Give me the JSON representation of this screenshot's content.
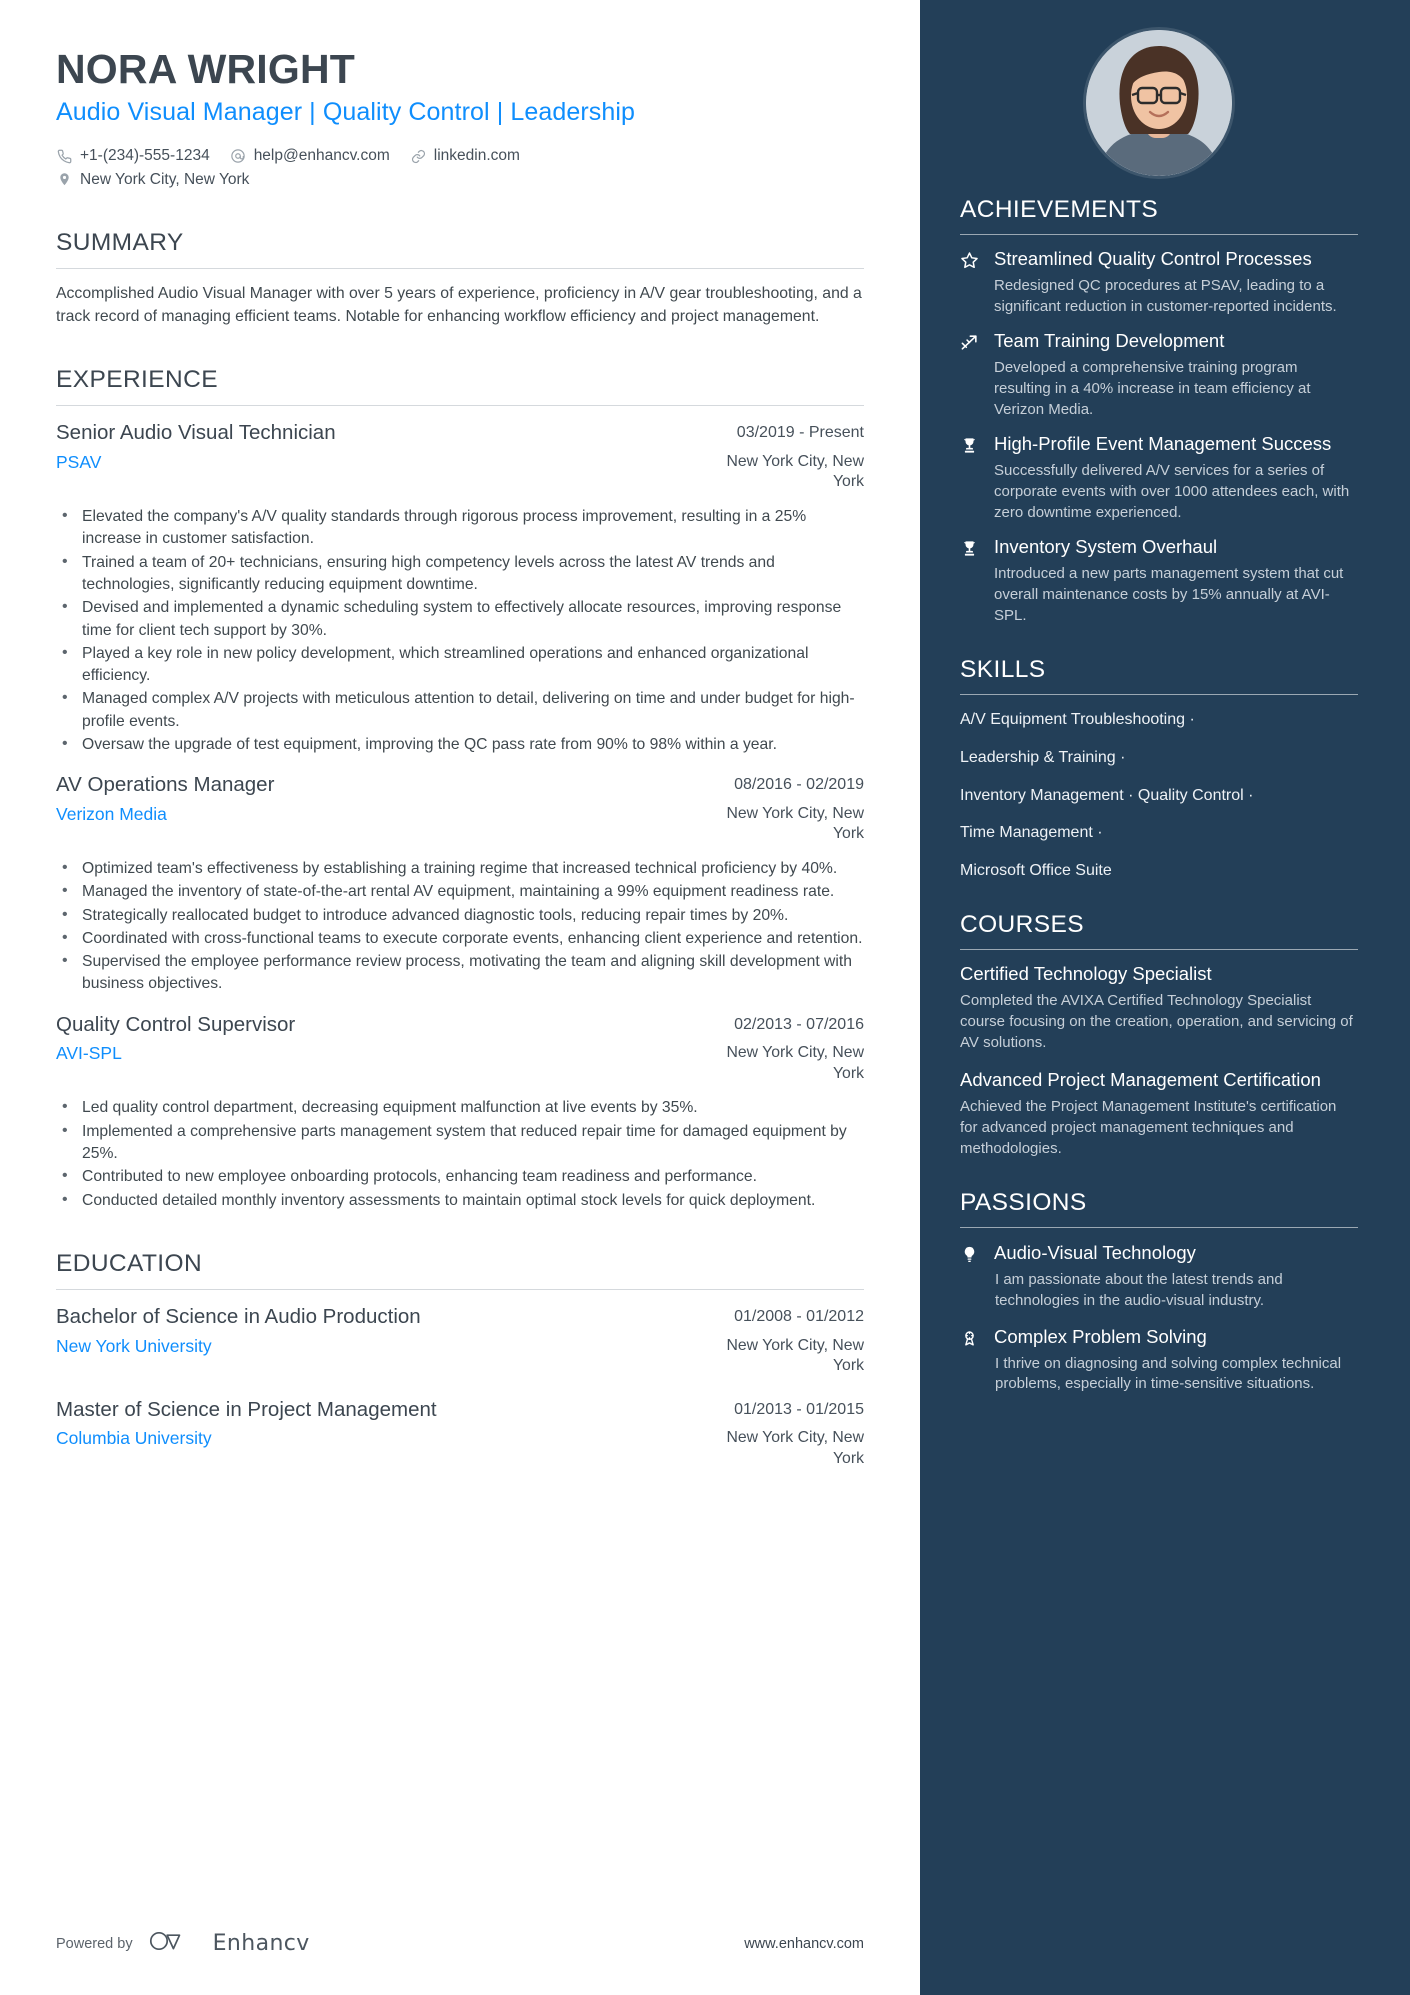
{
  "header": {
    "name": "NORA WRIGHT",
    "headline": "Audio Visual Manager | Quality Control | Leadership",
    "contacts": [
      {
        "icon": "phone-icon",
        "text": "+1-(234)-555-1234"
      },
      {
        "icon": "email-icon",
        "text": "help@enhancv.com"
      },
      {
        "icon": "link-icon",
        "text": "linkedin.com"
      }
    ],
    "location": {
      "icon": "location-pin-icon",
      "text": "New York City, New York"
    }
  },
  "summary": {
    "title": "SUMMARY",
    "text": "Accomplished Audio Visual Manager with over 5 years of experience, proficiency in A/V gear troubleshooting, and a track record of managing efficient teams. Notable for enhancing workflow efficiency and project management."
  },
  "experience": {
    "title": "EXPERIENCE",
    "entries": [
      {
        "role": "Senior Audio Visual Technician",
        "date": "03/2019 - Present",
        "company": "PSAV",
        "location": "New York City, New York",
        "bullets": [
          "Elevated the company's A/V quality standards through rigorous process improvement, resulting in a 25% increase in customer satisfaction.",
          "Trained a team of 20+ technicians, ensuring high competency levels across the latest AV trends and technologies, significantly reducing equipment downtime.",
          "Devised and implemented a dynamic scheduling system to effectively allocate resources, improving response time for client tech support by 30%.",
          "Played a key role in new policy development, which streamlined operations and enhanced organizational efficiency.",
          "Managed complex A/V projects with meticulous attention to detail, delivering on time and under budget for high-profile events.",
          "Oversaw the upgrade of test equipment, improving the QC pass rate from 90% to 98% within a year."
        ]
      },
      {
        "role": "AV Operations Manager",
        "date": "08/2016 - 02/2019",
        "company": "Verizon Media",
        "location": "New York City, New York",
        "bullets": [
          "Optimized team's effectiveness by establishing a training regime that increased technical proficiency by 40%.",
          "Managed the inventory of state-of-the-art rental AV equipment, maintaining a 99% equipment readiness rate.",
          "Strategically reallocated budget to introduce advanced diagnostic tools, reducing repair times by 20%.",
          "Coordinated with cross-functional teams to execute corporate events, enhancing client experience and retention.",
          "Supervised the employee performance review process, motivating the team and aligning skill development with business objectives."
        ]
      },
      {
        "role": "Quality Control Supervisor",
        "date": "02/2013 - 07/2016",
        "company": "AVI-SPL",
        "location": "New York City, New York",
        "bullets": [
          "Led quality control department, decreasing equipment malfunction at live events by 35%.",
          "Implemented a comprehensive parts management system that reduced repair time for damaged equipment by 25%.",
          "Contributed to new employee onboarding protocols, enhancing team readiness and performance.",
          "Conducted detailed monthly inventory assessments to maintain optimal stock levels for quick deployment."
        ]
      }
    ]
  },
  "education": {
    "title": "EDUCATION",
    "entries": [
      {
        "degree": "Bachelor of Science in Audio Production",
        "date": "01/2008 - 01/2012",
        "school": "New York University",
        "location": "New York City, New York"
      },
      {
        "degree": "Master of Science in Project Management",
        "date": "01/2013 - 01/2015",
        "school": "Columbia University",
        "location": "New York City, New York"
      }
    ]
  },
  "footer": {
    "powered_by": "Powered by",
    "brand": "Enhancv",
    "url": "www.enhancv.com"
  },
  "sidebar": {
    "achievements": {
      "title": "ACHIEVEMENTS",
      "items": [
        {
          "icon": "star-outline-icon",
          "title": "Streamlined Quality Control Processes",
          "desc": "Redesigned QC procedures at PSAV, leading to a significant reduction in customer-reported incidents."
        },
        {
          "icon": "chart-arrow-icon",
          "title": "Team Training Development",
          "desc": "Developed a comprehensive training program resulting in a 40% increase in team efficiency at Verizon Media."
        },
        {
          "icon": "trophy-icon",
          "title": "High-Profile Event Management Success",
          "desc": "Successfully delivered A/V services for a series of corporate events with over 1000 attendees each, with zero downtime experienced."
        },
        {
          "icon": "trophy-icon",
          "title": "Inventory System Overhaul",
          "desc": "Introduced a new parts management system that cut overall maintenance costs by 15% annually at AVI-SPL."
        }
      ]
    },
    "skills": {
      "title": "SKILLS",
      "lines": [
        "A/V Equipment Troubleshooting ·",
        "Leadership & Training ·",
        "Inventory Management · Quality Control ·",
        "Time Management ·",
        "Microsoft Office Suite"
      ]
    },
    "courses": {
      "title": "COURSES",
      "items": [
        {
          "title": "Certified Technology Specialist",
          "desc": "Completed the AVIXA Certified Technology Specialist course focusing on the creation, operation, and servicing of AV solutions."
        },
        {
          "title": "Advanced Project Management Certification",
          "desc": "Achieved the Project Management Institute's certification for advanced project management techniques and methodologies."
        }
      ]
    },
    "passions": {
      "title": "PASSIONS",
      "items": [
        {
          "icon": "lightbulb-icon",
          "title": "Audio-Visual Technology",
          "desc": "I am passionate about the latest trends and technologies in the audio-visual industry."
        },
        {
          "icon": "award-ribbon-icon",
          "title": "Complex Problem Solving",
          "desc": "I thrive on diagnosing and solving complex technical problems, especially in time-sensitive situations."
        }
      ]
    }
  },
  "colors": {
    "accent_blue": "#0f8efd",
    "sidebar_bg": "#233f58",
    "heading_gray": "#3c4650",
    "body_gray": "#40494f",
    "sidebar_muted": "#c6cfd8"
  }
}
